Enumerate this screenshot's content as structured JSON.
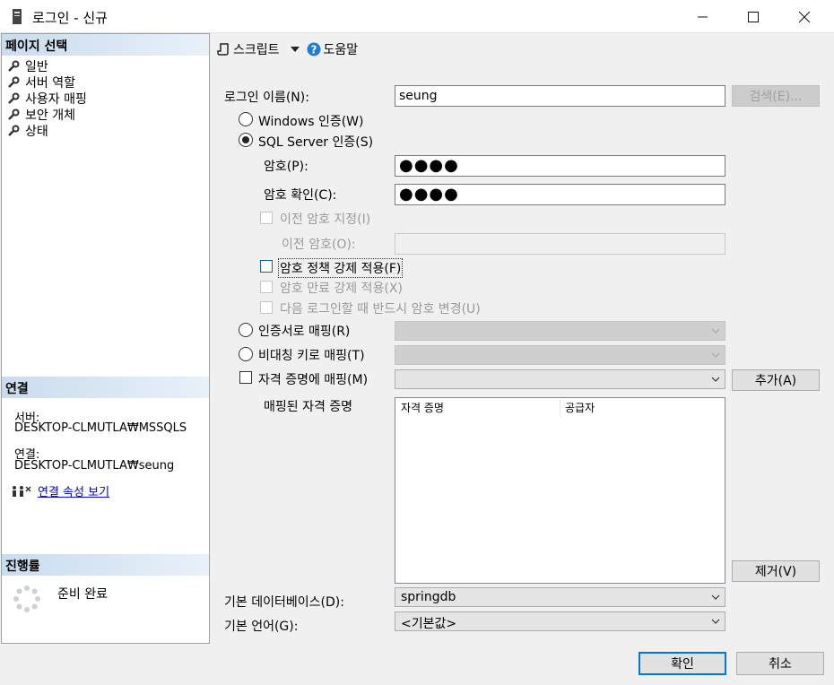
{
  "window": {
    "title": "로그인 - 신규",
    "minimize_icon": "minimize-icon",
    "maximize_icon": "maximize-icon",
    "close_icon": "close-icon"
  },
  "left": {
    "page_select_header": "페이지 선택",
    "pages": [
      {
        "label": "일반",
        "icon": "wrench-icon",
        "selected": true
      },
      {
        "label": "서버 역할",
        "icon": "wrench-icon"
      },
      {
        "label": "사용자 매핑",
        "icon": "wrench-icon"
      },
      {
        "label": "보안 개체",
        "icon": "wrench-icon"
      },
      {
        "label": "상태",
        "icon": "wrench-icon"
      }
    ],
    "connection_header": "연결",
    "server_label": "서버:",
    "server_value": "DESKTOP-CLMUTLA₩MSSQLS",
    "connection_label": "연결:",
    "connection_value": "DESKTOP-CLMUTLA₩seung",
    "view_props_link": "연결 속성 보기",
    "progress_header": "진행률",
    "progress_status": "준비 완료"
  },
  "toolbar": {
    "script_label": "스크립트",
    "help_label": "도움말"
  },
  "form": {
    "login_name_label": "로그인 이름(N):",
    "login_name_value": "seung",
    "search_button": "검색(E)...",
    "windows_auth_label": "Windows 인증(W)",
    "sql_auth_label": "SQL Server 인증(S)",
    "password_label": "암호(P):",
    "password_value": "●●●●",
    "confirm_label": "암호 확인(C):",
    "confirm_value": "●●●●",
    "old_pw_check_label": "이전 암호 지정(I)",
    "old_pw_label": "이전 암호(O):",
    "enforce_policy_label": "암호 정책 강제 적용(F)",
    "enforce_expiration_label": "암호 만료 강제 적용(X)",
    "must_change_label": "다음 로그인할 때 반드시 암호 변경(U)",
    "cert_map_label": "인증서로 매핑(R)",
    "asym_key_map_label": "비대칭 키로 매핑(T)",
    "credential_map_label": "자격 증명에 매핑(M)",
    "add_button": "추가(A)",
    "mapped_credentials_label": "매핑된 자격 증명",
    "col_credential": "자격 증명",
    "col_provider": "공급자",
    "remove_button": "제거(V)",
    "default_db_label": "기본 데이터베이스(D):",
    "default_db_value": "springdb",
    "default_lang_label": "기본 언어(G):",
    "default_lang_value": "<기본값>"
  },
  "footer": {
    "ok_button": "확인",
    "cancel_button": "취소"
  },
  "colors": {
    "accent": "#0078d7",
    "link": "#0000cc",
    "section_header": "#c9dcee"
  }
}
